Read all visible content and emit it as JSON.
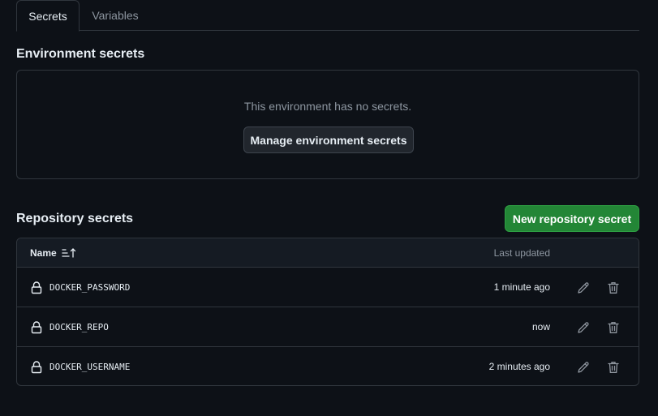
{
  "tabs": [
    {
      "label": "Secrets",
      "active": true
    },
    {
      "label": "Variables",
      "active": false
    }
  ],
  "environment": {
    "title": "Environment secrets",
    "empty_text": "This environment has no secrets.",
    "manage_button": "Manage environment secrets"
  },
  "repository": {
    "title": "Repository secrets",
    "new_button": "New repository secret",
    "columns": {
      "name": "Name",
      "updated": "Last updated"
    },
    "rows": [
      {
        "name": "DOCKER_PASSWORD",
        "updated": "1 minute ago"
      },
      {
        "name": "DOCKER_REPO",
        "updated": "now"
      },
      {
        "name": "DOCKER_USERNAME",
        "updated": "2 minutes ago"
      }
    ]
  },
  "colors": {
    "background": "#0d1117",
    "border": "#30363d",
    "primary_button": "#238636",
    "muted_text": "#8d96a0"
  },
  "icons": [
    "sort-icon",
    "lock-icon",
    "pencil-icon",
    "trash-icon"
  ]
}
